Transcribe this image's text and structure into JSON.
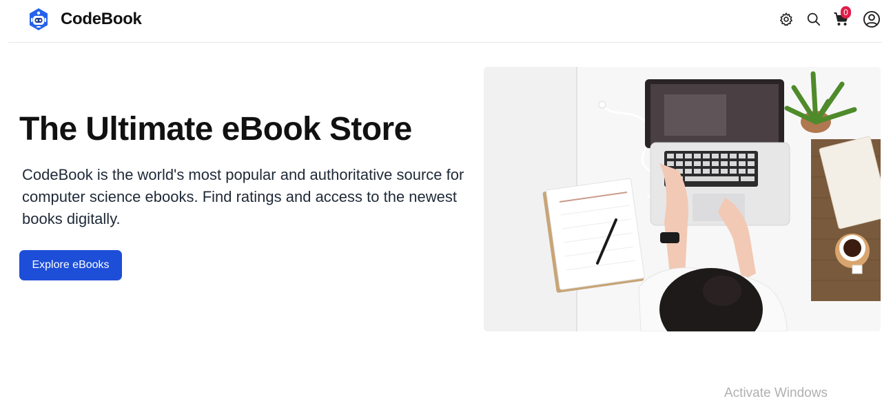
{
  "brand": {
    "name": "CodeBook",
    "logo_icon": "robot-logo-icon",
    "logo_color": "#2563eb"
  },
  "nav": {
    "icons": [
      "settings-icon",
      "search-icon",
      "cart-icon",
      "user-account-icon"
    ],
    "cart_count": "0",
    "badge_color": "#e11d48"
  },
  "hero": {
    "title": "The Ultimate eBook Store",
    "description": "CodeBook is the world's most popular and authoritative source for computer science ebooks. Find ratings and access to the newest books digitally.",
    "cta_label": "Explore eBooks",
    "cta_color": "#1d4ed8"
  },
  "system": {
    "watermark": "Activate Windows"
  }
}
